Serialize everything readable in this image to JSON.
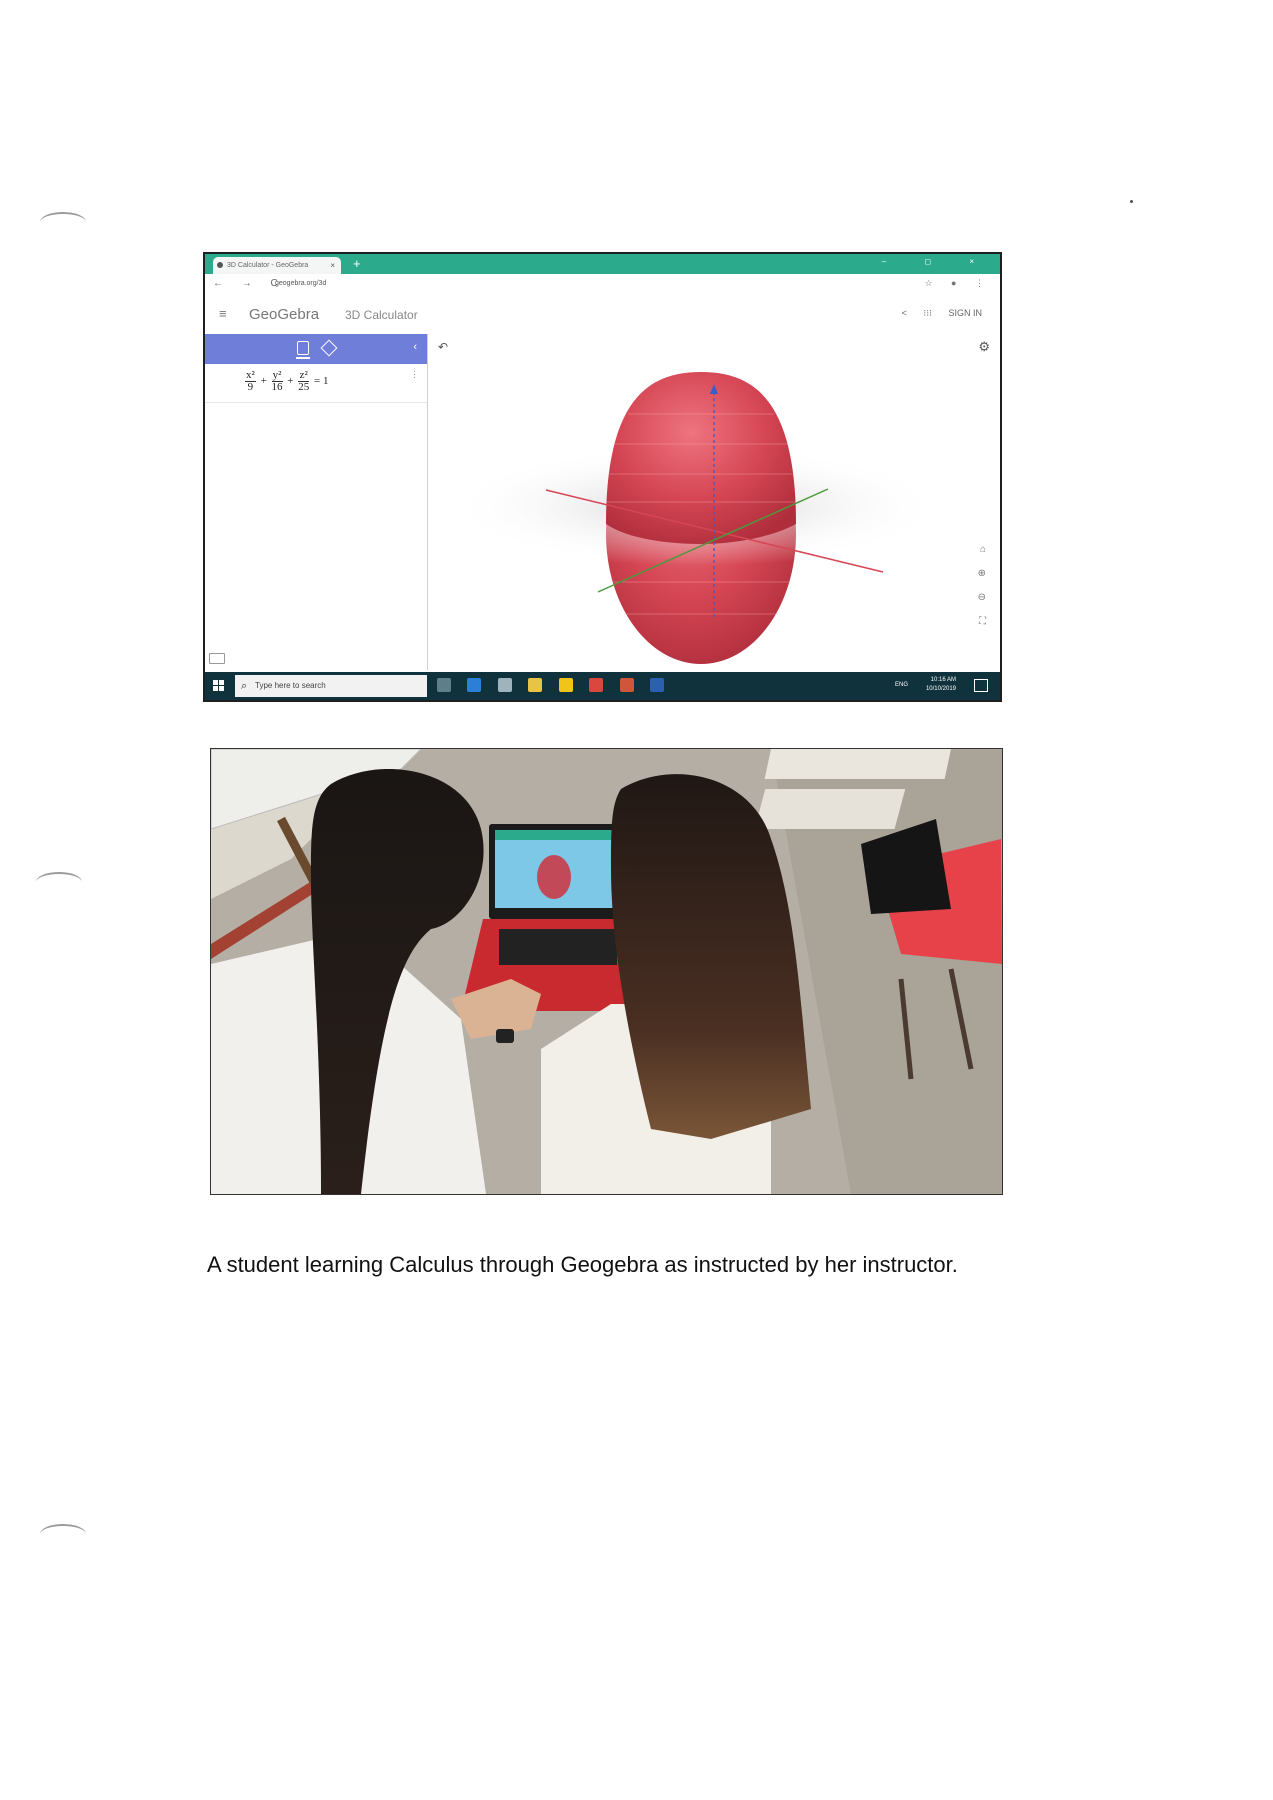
{
  "caption": "A student learning Calculus through Geogebra as instructed by her instructor.",
  "screenshot": {
    "tab_title": "3D Calculator - GeoGebra",
    "tab_close": "×",
    "new_tab": "+",
    "window_controls": "– ◻ ×",
    "nav_buttons": "← → C",
    "url": "geogebra.org/3d",
    "addr_icons": "☆ ● ⋮",
    "menu_icon": "≡",
    "brand": "GeoGebra",
    "subtitle": "3D Calculator",
    "share_icon": "<",
    "apps_icon": "⁝⁝⁝",
    "sign_in": "SIGN IN",
    "collapse_icon": "‹",
    "kebab": "⋮",
    "equation": {
      "x_num": "x²",
      "x_den": "9",
      "y_num": "y²",
      "y_den": "16",
      "z_num": "z²",
      "z_den": "25",
      "plus": "+",
      "rhs": "= 1"
    },
    "undo_icon": "↶",
    "gear_icon": "⚙",
    "home_icon": "⌂",
    "zoom_in_icon": "⊕",
    "zoom_out_icon": "⊖",
    "fullscreen_icon": "⛶",
    "search_placeholder": "Type here to search",
    "tray_lang": "ENG",
    "tray_time": "10:16 AM",
    "tray_date": "10/10/2019"
  },
  "colors": {
    "tab_bar": "#2bab8c",
    "algebra_header": "#6f7fd9",
    "ellipsoid": "#d64654",
    "taskbar": "#10323c"
  }
}
